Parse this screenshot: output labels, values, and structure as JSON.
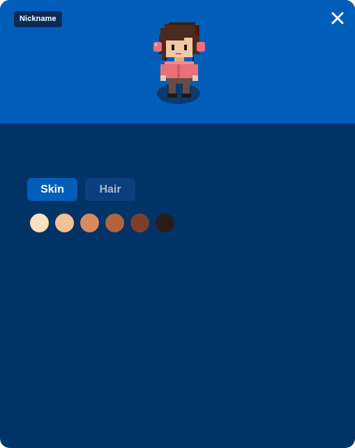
{
  "header": {
    "nickname_label": "Nickname",
    "close_icon": "close-icon",
    "background_color": "#005ebb"
  },
  "avatar": {
    "description_icon": "pixel-character-avatar",
    "skin_color": "#f2c7a4",
    "hair_color": "#4a2a1e",
    "shirt_color": "#e8707a",
    "pants_color": "#6a4a44",
    "headphones_color": "#e86f7d",
    "shadow_color": "#0b3a6e"
  },
  "customizer": {
    "tabs": [
      {
        "label": "Skin",
        "selected": true
      },
      {
        "label": "Hair",
        "selected": false
      }
    ],
    "skin_swatches": [
      {
        "color": "#fde0c0"
      },
      {
        "color": "#f4c095"
      },
      {
        "color": "#d9895e"
      },
      {
        "color": "#b06540"
      },
      {
        "color": "#7e3f28"
      },
      {
        "color": "#2a1c1c"
      }
    ]
  },
  "colors": {
    "panel_background": "#003366",
    "accent": "#005ebb"
  }
}
